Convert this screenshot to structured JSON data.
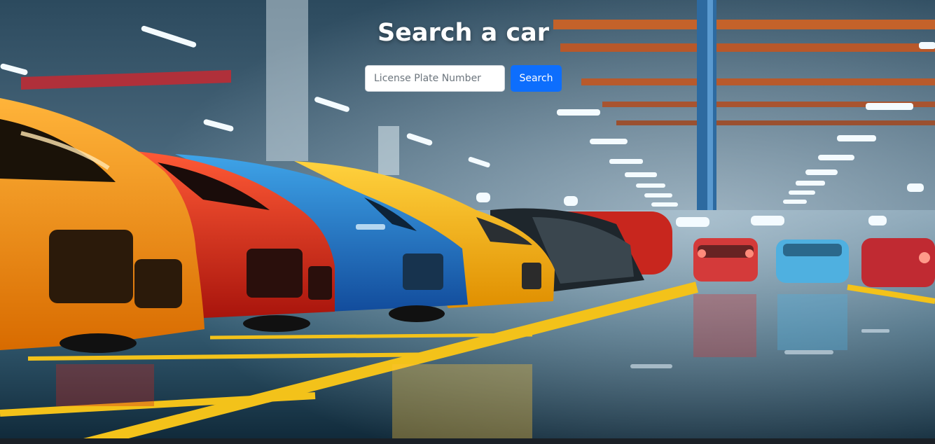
{
  "hero": {
    "title": "Search a car"
  },
  "search": {
    "placeholder": "License Plate Number",
    "value": "",
    "button_label": "Search"
  },
  "colors": {
    "button": "#0d6efd",
    "title": "#ffffff"
  }
}
